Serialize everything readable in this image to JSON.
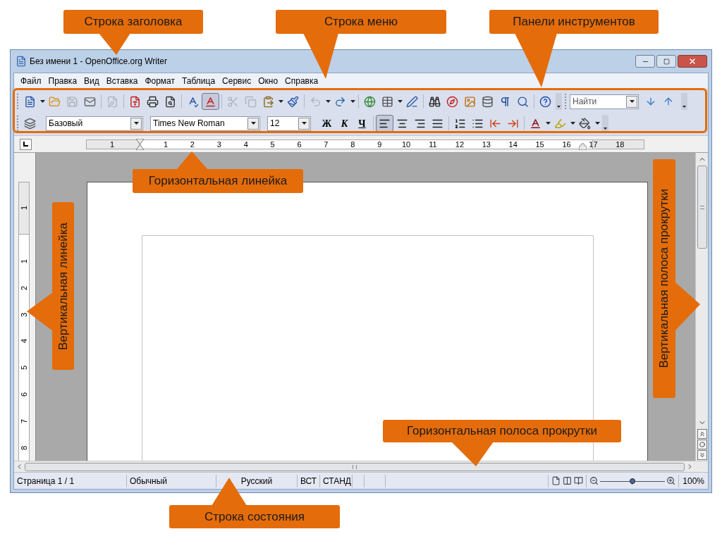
{
  "callouts": [
    "Строка заголовка",
    "Строка меню",
    "Панели инструментов",
    "Горизонтальная линейка",
    "Вертикальная линейка",
    "Вертикальная полоса прокрутки",
    "Горизонтальная полоса прокрутки",
    "Строка состояния"
  ],
  "window": {
    "title": "Без имени 1 - OpenOffice.org Writer"
  },
  "menu": [
    "Файл",
    "Правка",
    "Вид",
    "Вставка",
    "Формат",
    "Таблица",
    "Сервис",
    "Окно",
    "Справка"
  ],
  "standard_toolbar": [
    {
      "disabled": false,
      "pressed": false
    },
    {
      "disabled": false,
      "pressed": false
    },
    {
      "disabled": true,
      "pressed": false
    },
    {
      "disabled": false,
      "pressed": false
    },
    {
      "disabled": true,
      "pressed": false
    },
    {
      "disabled": false,
      "pressed": false
    },
    {
      "disabled": false,
      "pressed": false
    },
    {
      "disabled": false,
      "pressed": false
    },
    {
      "disabled": false,
      "pressed": false
    },
    {
      "disabled": false,
      "pressed": true
    },
    {
      "disabled": true,
      "pressed": false
    },
    {
      "disabled": true,
      "pressed": false
    },
    {
      "disabled": false,
      "pressed": false
    },
    {
      "disabled": false,
      "pressed": false
    },
    {
      "disabled": true,
      "pressed": false
    },
    {
      "disabled": false,
      "pressed": false
    },
    {
      "disabled": false,
      "pressed": false
    },
    {
      "disabled": false,
      "pressed": false
    },
    {
      "disabled": false,
      "pressed": false
    },
    {
      "disabled": false,
      "pressed": false
    },
    {
      "disabled": false,
      "pressed": false
    },
    {
      "disabled": false,
      "pressed": false
    },
    {
      "disabled": false,
      "pressed": false
    },
    {
      "disabled": false,
      "pressed": false
    },
    {
      "disabled": false,
      "pressed": false
    },
    {
      "disabled": false,
      "pressed": false
    }
  ],
  "find_toolbar": {
    "placeholder": "Найти"
  },
  "formatting_toolbar": {
    "style": "Базовый",
    "font": "Times New Roman",
    "size": "12",
    "text_buttons": [
      {
        "label": "Ж",
        "pressed": false
      },
      {
        "label": "К",
        "pressed": false
      },
      {
        "label": "Ч",
        "pressed": false
      }
    ],
    "buttons": [
      {
        "pressed": true
      },
      {
        "pressed": false
      },
      {
        "pressed": false
      },
      {
        "pressed": false
      },
      {
        "pressed": false
      },
      {
        "pressed": false
      },
      {
        "pressed": false
      },
      {
        "pressed": false
      },
      {
        "pressed": false
      },
      {
        "pressed": false
      },
      {
        "pressed": false
      }
    ]
  },
  "horizontal_ruler": [
    "1",
    "1",
    "2",
    "3",
    "4",
    "5",
    "6",
    "7",
    "8",
    "9",
    "10",
    "11",
    "12",
    "13",
    "14",
    "15",
    "16",
    "17",
    "18"
  ],
  "vertical_ruler": [
    "1",
    "1",
    "2",
    "3",
    "4",
    "5",
    "6",
    "7",
    "8"
  ],
  "status_bar": {
    "cells": [
      "Страница 1 / 1",
      "Обычный",
      "Русский",
      "ВСТ",
      "СТАНД"
    ],
    "zoom": {
      "level": 0.5,
      "reading": "100%"
    }
  }
}
